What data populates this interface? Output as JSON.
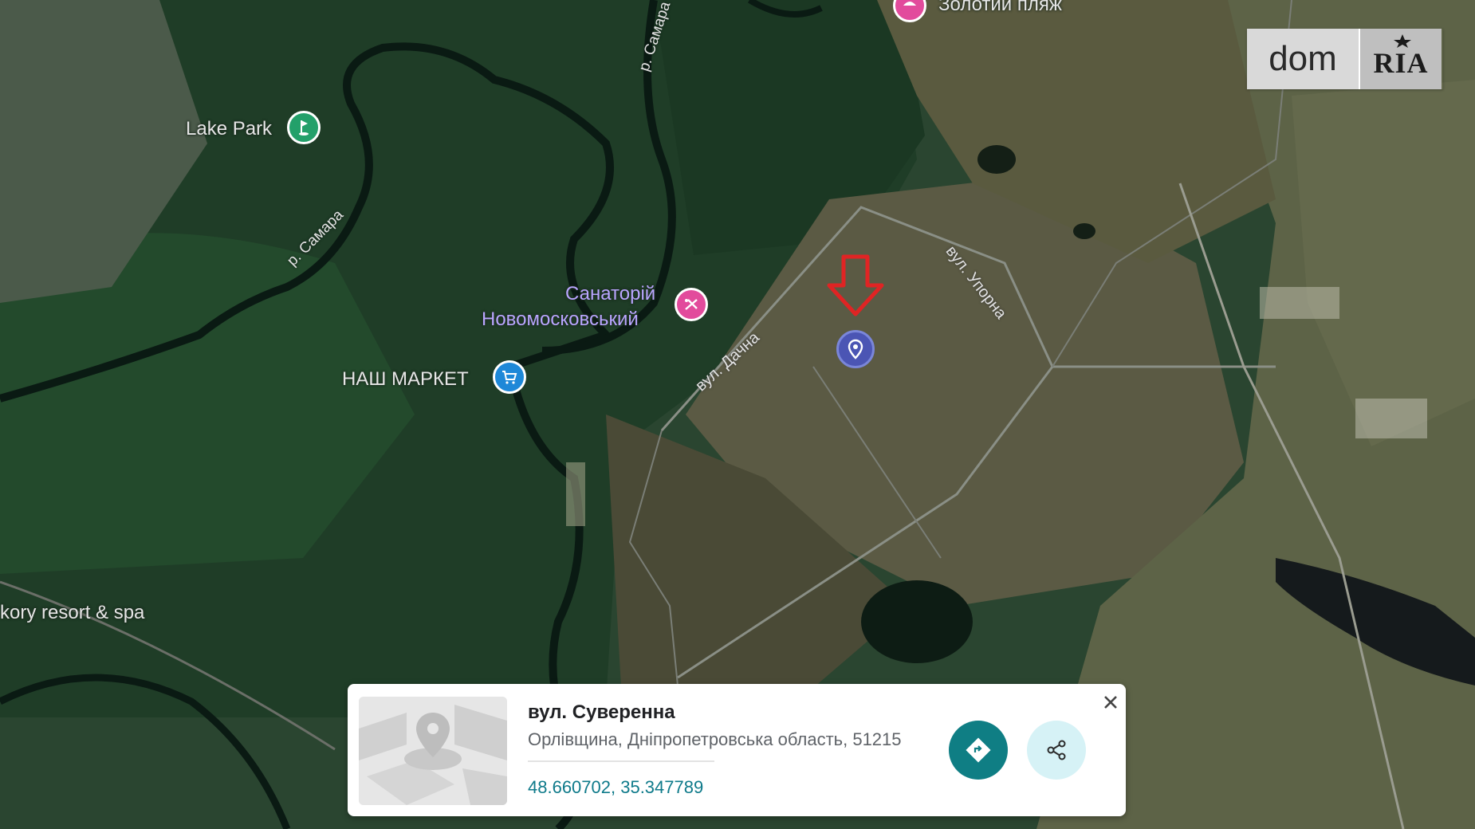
{
  "logo": {
    "part1": "dom",
    "part2": "RIA"
  },
  "pois": {
    "lake_park": "Lake Park",
    "zolotyi_plyazh": "Золотий пляж",
    "sanatorium_line1": "Санаторій",
    "sanatorium_line2": "Новомосковський",
    "nash_market": "НАШ МАРКЕТ",
    "resort": "kory resort & spa"
  },
  "streets": {
    "dachna": "вул. Дачна",
    "uporna": "вул. Упорна"
  },
  "rivers": {
    "samara_1": "р. Самара",
    "samara_2": "р. Самара"
  },
  "card": {
    "title": "вул. Суверенна",
    "address": "Орлівщина, Дніпропетровська область, 51215",
    "coordinates": "48.660702, 35.347789"
  },
  "colors": {
    "directions_button": "#0f7e84",
    "share_button": "#d6f2f6",
    "location_pin": "#4b55b4",
    "arrow": "#e02424"
  },
  "icons": [
    "golf-icon",
    "beach-icon",
    "spa-icon",
    "shopping-cart-icon",
    "location-pin-icon",
    "directions-icon",
    "share-icon",
    "close-icon"
  ]
}
